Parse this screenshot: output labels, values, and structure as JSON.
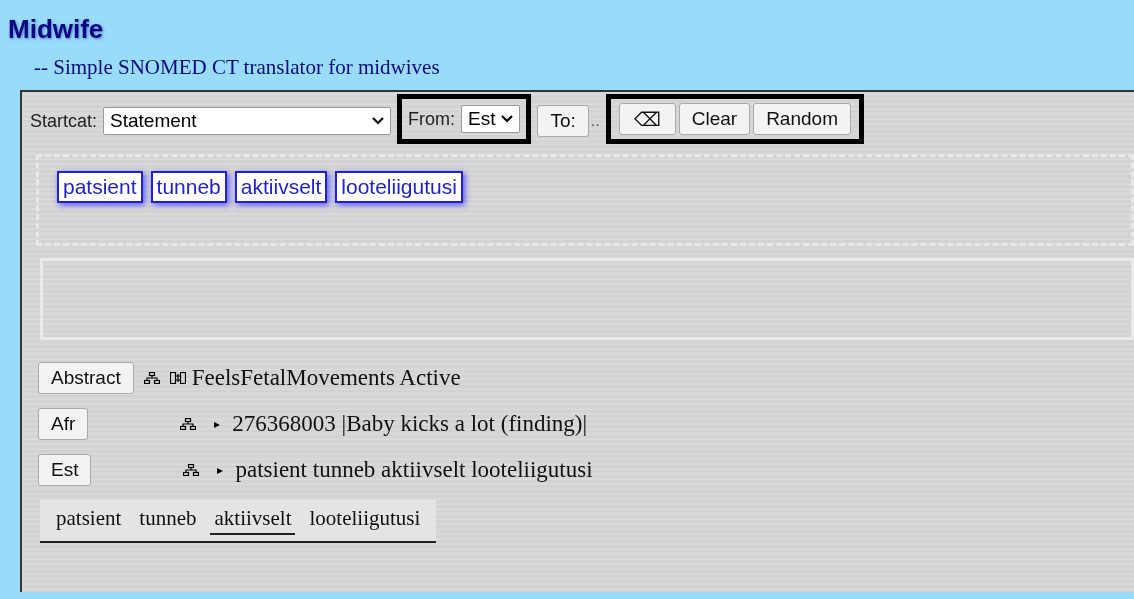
{
  "header": {
    "title": "Midwife",
    "subtitle": "-- Simple SNOMED CT translator for midwives"
  },
  "toolbar": {
    "startcat_label": "Startcat:",
    "startcat_value": "Statement",
    "from_label": "From:",
    "from_value": "Est",
    "to_button": "To:",
    "to_more": "..",
    "buttons": [
      {
        "label": "⌫",
        "kind": "backspace"
      },
      {
        "label": "Clear",
        "kind": "clear"
      },
      {
        "label": "Random",
        "kind": "random"
      }
    ]
  },
  "tokens": [
    "patsient",
    "tunneb",
    "aktiivselt",
    "looteliigutusi"
  ],
  "linearizations": [
    {
      "language": "Abstract",
      "kind": "abstract",
      "text": "FeelsFetalMovements Active"
    },
    {
      "language": "Afr",
      "kind": "concrete",
      "arrow": "▸",
      "text": "276368003 |Baby kicks a lot (finding)|"
    },
    {
      "language": "Est",
      "kind": "concrete",
      "arrow": "▸",
      "text": "patsient tunneb aktiivselt looteliigutusi"
    }
  ],
  "word_line": [
    {
      "word": "patsient",
      "selected": false
    },
    {
      "word": "tunneb",
      "selected": false
    },
    {
      "word": "aktiivselt",
      "selected": true
    },
    {
      "word": "looteliigutusi",
      "selected": false
    }
  ]
}
